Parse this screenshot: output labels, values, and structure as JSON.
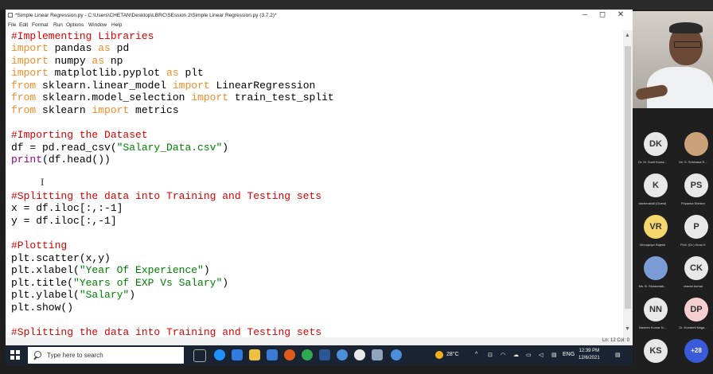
{
  "window": {
    "title": "*Simple Linear Regression.py - C:\\Users\\CHETAN\\Desktop\\LBRC\\SEssion 2\\Simple Linear Regression.py (3.7.2)*",
    "minimize": "–",
    "maximize": "◻",
    "close": "✕"
  },
  "menu": [
    "File",
    "Edit",
    "Format",
    "Run",
    "Options",
    "Window",
    "Help"
  ],
  "code": [
    [
      {
        "t": "#Implementing Libraries",
        "c": "cm"
      }
    ],
    [
      {
        "t": "import",
        "c": "kw"
      },
      {
        "t": " pandas "
      },
      {
        "t": "as",
        "c": "kw"
      },
      {
        "t": " pd"
      }
    ],
    [
      {
        "t": "import",
        "c": "kw"
      },
      {
        "t": " numpy "
      },
      {
        "t": "as",
        "c": "kw"
      },
      {
        "t": " np"
      }
    ],
    [
      {
        "t": "import",
        "c": "kw"
      },
      {
        "t": " matplotlib.pyplot "
      },
      {
        "t": "as",
        "c": "kw"
      },
      {
        "t": " plt"
      }
    ],
    [
      {
        "t": "from",
        "c": "kw"
      },
      {
        "t": " sklearn.linear_model "
      },
      {
        "t": "import",
        "c": "kw"
      },
      {
        "t": " LinearRegression"
      }
    ],
    [
      {
        "t": "from",
        "c": "kw"
      },
      {
        "t": " sklearn.model_selection "
      },
      {
        "t": "import",
        "c": "kw"
      },
      {
        "t": " train_test_split"
      }
    ],
    [
      {
        "t": "from",
        "c": "kw"
      },
      {
        "t": " sklearn "
      },
      {
        "t": "import",
        "c": "kw"
      },
      {
        "t": " metrics"
      }
    ],
    [],
    [
      {
        "t": "#Importing the Dataset",
        "c": "cm"
      }
    ],
    [
      {
        "t": "df = pd.read_csv("
      },
      {
        "t": "\"Salary_Data.csv\"",
        "c": "st"
      },
      {
        "t": ")"
      }
    ],
    [
      {
        "t": "print",
        "c": "bi"
      },
      {
        "t": "(df.head())"
      }
    ],
    [],
    [],
    [
      {
        "t": "#Splitting the data into Training and Testing sets",
        "c": "cm"
      }
    ],
    [
      {
        "t": "x = df.iloc[:,:-1]"
      }
    ],
    [
      {
        "t": "y = df.iloc[:,-1]"
      }
    ],
    [],
    [
      {
        "t": "#Plotting",
        "c": "cm"
      }
    ],
    [
      {
        "t": "plt.scatter(x,y)"
      }
    ],
    [
      {
        "t": "plt.xlabel("
      },
      {
        "t": "\"Year Of Experience\"",
        "c": "st"
      },
      {
        "t": ")"
      }
    ],
    [
      {
        "t": "plt.title("
      },
      {
        "t": "\"Years of EXP Vs Salary\"",
        "c": "st"
      },
      {
        "t": ")"
      }
    ],
    [
      {
        "t": "plt.ylabel("
      },
      {
        "t": "\"Salary\"",
        "c": "st"
      },
      {
        "t": ")"
      }
    ],
    [
      {
        "t": "plt.show()"
      }
    ],
    [],
    [
      {
        "t": "#Splitting the data into Training and Testing sets",
        "c": "cm"
      }
    ]
  ],
  "status": "Ln: 12  Col: 0",
  "taskbar": {
    "search_placeholder": "Type here to search",
    "temperature": "28°C",
    "language": "ENG",
    "time": "12:39 PM",
    "date": "12/6/2021"
  },
  "participants": [
    {
      "initials": "DK",
      "name": "Dr. M. Sunil Kuma...",
      "color": "#e8e8e8",
      "photo": false
    },
    {
      "initials": "",
      "name": "Mr. S. Srinivasa R...",
      "color": "#c9a27a",
      "photo": true
    },
    {
      "initials": "K",
      "name": "latchmaiddi (Guest)",
      "color": "#e8e8e8",
      "photo": false
    },
    {
      "initials": "PS",
      "name": "Priyanka Shinkre",
      "color": "#e8e8e8",
      "photo": false
    },
    {
      "initials": "VR",
      "name": "Vinnupriya Rajesh",
      "color": "#f5d76e",
      "photo": false
    },
    {
      "initials": "P",
      "name": "Prof. (Dr.) Kiran K",
      "color": "#e8e8e8",
      "photo": false
    },
    {
      "initials": "",
      "name": "Ms. B. Sivaramak...",
      "color": "#7a9bd4",
      "photo": true
    },
    {
      "initials": "CK",
      "name": "charan kumar",
      "color": "#e8e8e8",
      "photo": false
    },
    {
      "initials": "NN",
      "name": "Naveen Kumar N...",
      "color": "#e8e8e8",
      "photo": false
    },
    {
      "initials": "DP",
      "name": "Dr. Kunderti Naga...",
      "color": "#f5cfcf",
      "photo": false
    },
    {
      "initials": "KS",
      "name": "",
      "color": "#e8e8e8",
      "photo": false
    },
    {
      "initials": "+28",
      "name": "",
      "color": "#3a5bd9",
      "photo": false
    }
  ]
}
